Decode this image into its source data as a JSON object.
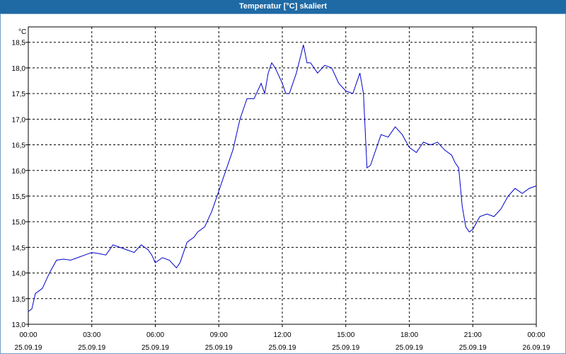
{
  "window": {
    "title": "Temperatur [°C] skaliert"
  },
  "chart_data": {
    "type": "line",
    "ylabel": "°C",
    "ylim": [
      13.0,
      18.5
    ],
    "xlim": [
      "2019-09-25 00:00",
      "2019-09-26 00:00"
    ],
    "grid": true,
    "line_color": "#0000cc",
    "y_ticks": [
      "13,0",
      "13,5",
      "14,0",
      "14,5",
      "15,0",
      "15,5",
      "16,0",
      "16,5",
      "17,0",
      "17,5",
      "18,0",
      "18,5"
    ],
    "x_ticks": [
      {
        "time": "00:00",
        "date": "25.09.19"
      },
      {
        "time": "03:00",
        "date": "25.09.19"
      },
      {
        "time": "06:00",
        "date": "25.09.19"
      },
      {
        "time": "09:00",
        "date": "25.09.19"
      },
      {
        "time": "12:00",
        "date": "25.09.19"
      },
      {
        "time": "15:00",
        "date": "25.09.19"
      },
      {
        "time": "18:00",
        "date": "25.09.19"
      },
      {
        "time": "21:00",
        "date": "25.09.19"
      },
      {
        "time": "00:00",
        "date": "26.09.19"
      }
    ],
    "series": [
      {
        "x": [
          "00:00",
          "00:10",
          "00:20",
          "00:40",
          "01:00",
          "01:20",
          "01:40",
          "02:00",
          "02:20",
          "02:40",
          "03:00",
          "03:20",
          "03:40",
          "04:00",
          "04:20",
          "04:40",
          "05:00",
          "05:20",
          "05:40",
          "05:50",
          "06:00",
          "06:10",
          "06:20",
          "06:40",
          "07:00",
          "07:10",
          "07:30",
          "07:50",
          "08:00",
          "08:20",
          "08:40",
          "09:00",
          "09:20",
          "09:40",
          "10:00",
          "10:20",
          "10:40",
          "11:00",
          "11:10",
          "11:20",
          "11:30",
          "11:40",
          "12:00",
          "12:10",
          "12:20",
          "12:40",
          "13:00",
          "13:10",
          "13:20",
          "13:40",
          "14:00",
          "14:20",
          "14:40",
          "15:00",
          "15:20",
          "15:40",
          "15:50",
          "16:00",
          "16:10",
          "16:20",
          "16:40",
          "17:00",
          "17:20",
          "17:40",
          "18:00",
          "18:20",
          "18:40",
          "19:00",
          "19:20",
          "19:40",
          "20:00",
          "20:10",
          "20:20",
          "20:30",
          "20:40",
          "20:50",
          "21:00",
          "21:20",
          "21:40",
          "22:00",
          "22:20",
          "22:40",
          "23:00",
          "23:20",
          "23:40",
          "24:00"
        ],
        "values": [
          13.25,
          13.3,
          13.6,
          13.7,
          14.0,
          14.25,
          14.27,
          14.25,
          14.3,
          14.35,
          14.4,
          14.38,
          14.35,
          14.55,
          14.5,
          14.45,
          14.4,
          14.55,
          14.45,
          14.35,
          14.2,
          14.25,
          14.3,
          14.25,
          14.1,
          14.2,
          14.6,
          14.7,
          14.8,
          14.9,
          15.2,
          15.6,
          16.0,
          16.4,
          17.0,
          17.4,
          17.4,
          17.7,
          17.5,
          17.9,
          18.1,
          18.0,
          17.7,
          17.5,
          17.5,
          17.9,
          18.45,
          18.1,
          18.1,
          17.9,
          18.05,
          18.0,
          17.7,
          17.55,
          17.5,
          17.9,
          17.5,
          16.05,
          16.1,
          16.3,
          16.7,
          16.65,
          16.85,
          16.7,
          16.45,
          16.35,
          16.55,
          16.5,
          16.55,
          16.4,
          16.3,
          16.15,
          16.05,
          15.3,
          14.9,
          14.8,
          14.85,
          15.1,
          15.15,
          15.1,
          15.25,
          15.5,
          15.65,
          15.55,
          15.65,
          15.7
        ]
      }
    ]
  }
}
